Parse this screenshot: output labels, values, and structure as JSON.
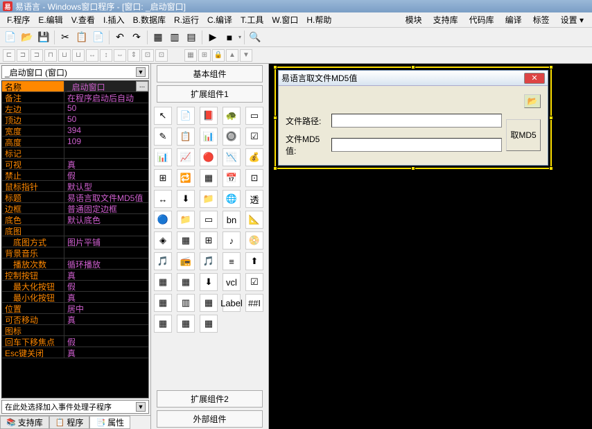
{
  "title": "易语言 - Windows窗口程序 - [窗口: _启动窗口]",
  "logo_char": "易",
  "menus": {
    "file": "F.程序",
    "edit": "E.编辑",
    "view": "V.查看",
    "insert": "I.插入",
    "database": "B.数据库",
    "run": "R.运行",
    "compile": "C.编译",
    "tools": "T.工具",
    "window": "W.窗口",
    "help": "H.帮助"
  },
  "right_menus": {
    "module": "模块",
    "support": "支持库",
    "codelib": "代码库",
    "translate": "编译",
    "tags": "标签",
    "settings": "设置 ▾"
  },
  "combo": {
    "value": "_启动窗口 (窗口)",
    "arrow": "▼"
  },
  "properties": [
    {
      "name": "名称",
      "value": "_启动窗口",
      "selected": true,
      "btn": "..."
    },
    {
      "name": "备注",
      "value": "在程序启动后自动"
    },
    {
      "name": "左边",
      "value": "50"
    },
    {
      "name": "顶边",
      "value": "50"
    },
    {
      "name": "宽度",
      "value": "394"
    },
    {
      "name": "高度",
      "value": "109"
    },
    {
      "name": "标记",
      "value": ""
    },
    {
      "name": "可视",
      "value": "真"
    },
    {
      "name": "禁止",
      "value": "假"
    },
    {
      "name": "鼠标指针",
      "value": "默认型"
    },
    {
      "name": "标题",
      "value": "易语言取文件MD5值"
    },
    {
      "name": "边框",
      "value": "普通固定边框"
    },
    {
      "name": "底色",
      "value": "默认底色"
    },
    {
      "name": "底图",
      "value": ""
    },
    {
      "name": "底图方式",
      "value": "图片平铺",
      "indent": true
    },
    {
      "name": "背景音乐",
      "value": ""
    },
    {
      "name": "播放次数",
      "value": "循环播放",
      "indent": true
    },
    {
      "name": "控制按钮",
      "value": "真"
    },
    {
      "name": "最大化按钮",
      "value": "假",
      "indent": true
    },
    {
      "name": "最小化按钮",
      "value": "真",
      "indent": true
    },
    {
      "name": "位置",
      "value": "居中"
    },
    {
      "name": "可否移动",
      "value": "真"
    },
    {
      "name": "图标",
      "value": ""
    },
    {
      "name": "回车下移焦点",
      "value": "假"
    },
    {
      "name": "Esc键关闭",
      "value": "真"
    }
  ],
  "event_combo": {
    "value": "在此处选择加入事件处理子程序",
    "arrow": "▼"
  },
  "bottom_tabs": {
    "support": "支持库",
    "program": "程序",
    "property": "属性"
  },
  "mid_panel": {
    "basic": "基本组件",
    "ext1": "扩展组件1",
    "ext2": "扩展组件2",
    "external": "外部组件"
  },
  "comp_icons": [
    "↖",
    "📄",
    "📕",
    "🐢",
    "▭",
    "✎",
    "📋",
    "📊",
    "🔘",
    "☑",
    "📊",
    "📈",
    "🔴",
    "📉",
    "💰",
    "⊞",
    "🔁",
    "▦",
    "📅",
    "⊡",
    "↔",
    "⬇",
    "📁",
    "🌐",
    "透",
    "🔵",
    "📁",
    "▭",
    "bn",
    "📐",
    "◈",
    "▦",
    "⊞",
    "♪",
    "📀",
    "🎵",
    "📻",
    "🎵",
    "≡",
    "⬆",
    "▦",
    "▦",
    "⬇",
    "vcl",
    "☑",
    "▦",
    "▥",
    "▦",
    "Label",
    "##I",
    "▦",
    "▦",
    "▦"
  ],
  "form": {
    "title": "易语言取文件MD5值",
    "close": "✕",
    "path_label": "文件路径:",
    "md5_label": "文件MD5值:",
    "browse_icon": "📂",
    "get_btn": "取MD5"
  }
}
